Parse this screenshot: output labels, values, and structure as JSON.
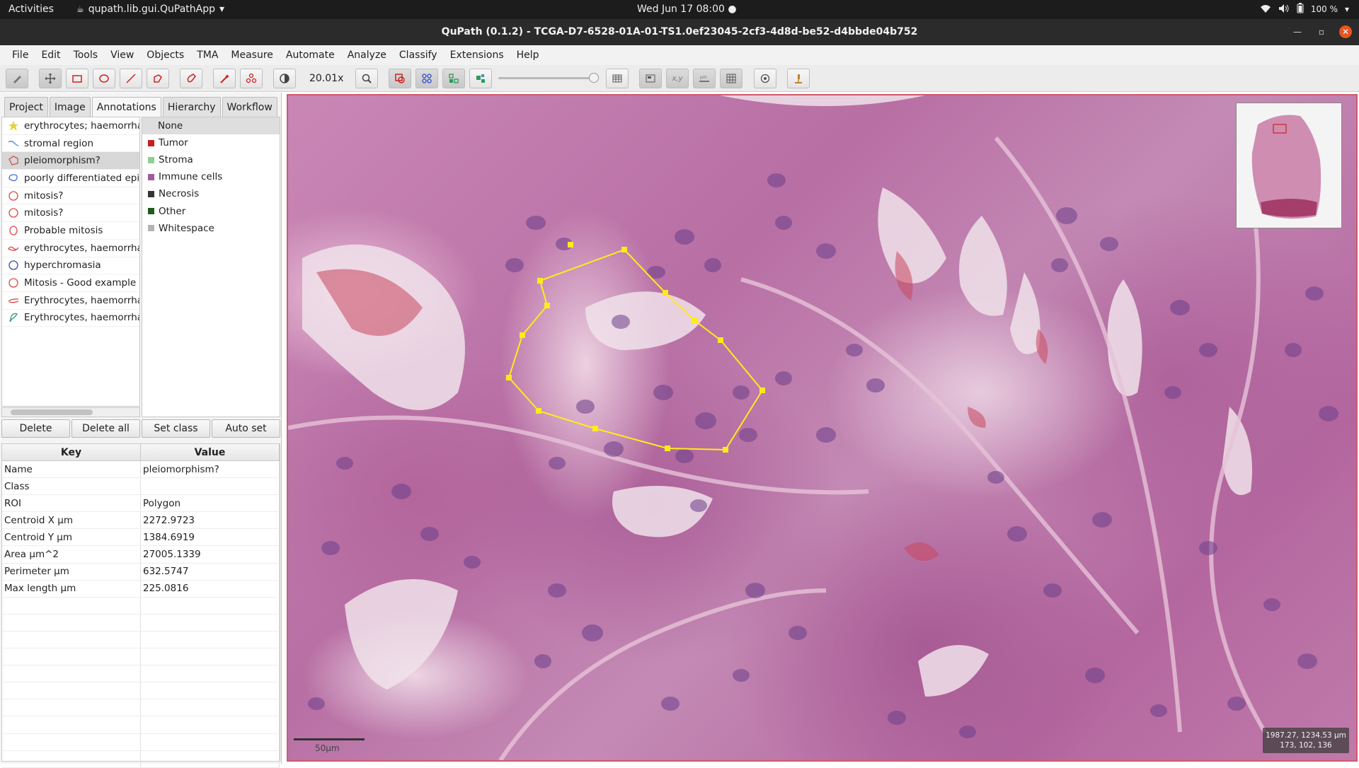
{
  "system": {
    "activities": "Activities",
    "app_menu": "qupath.lib.gui.QuPathApp",
    "clock": "Wed Jun 17  08:00",
    "battery": "100 %"
  },
  "window": {
    "title": "QuPath (0.1.2) - TCGA-D7-6528-01A-01-TS1.0ef23045-2cf3-4d8d-be52-d4bbde04b752"
  },
  "menu": [
    "File",
    "Edit",
    "Tools",
    "View",
    "Objects",
    "TMA",
    "Measure",
    "Automate",
    "Analyze",
    "Classify",
    "Extensions",
    "Help"
  ],
  "toolbar": {
    "zoom": "20.01x"
  },
  "tabs": [
    "Project",
    "Image",
    "Annotations",
    "Hierarchy",
    "Workflow"
  ],
  "selected_tab": "Annotations",
  "annotations": [
    {
      "label": "erythrocytes; haemorrhag",
      "icon": "star-icon",
      "color": "#e8d23a"
    },
    {
      "label": "stromal region",
      "icon": "polyline-icon",
      "color": "#6a8fd8"
    },
    {
      "label": "pleiomorphism?",
      "icon": "polygon-icon",
      "color": "#d84a4a"
    },
    {
      "label": "poorly differentiated epith",
      "icon": "polygon-icon",
      "color": "#4a6ad8"
    },
    {
      "label": "mitosis?",
      "icon": "ellipse-icon",
      "color": "#d84a4a"
    },
    {
      "label": "mitosis?",
      "icon": "ellipse-icon",
      "color": "#d84a4a"
    },
    {
      "label": "Probable mitosis",
      "icon": "ellipse-icon",
      "color": "#d84a4a"
    },
    {
      "label": "erythrocytes, haemorrhag",
      "icon": "polygon-icon",
      "color": "#d84a4a"
    },
    {
      "label": "hyperchromasia",
      "icon": "ellipse-icon",
      "color": "#3a4aa8"
    },
    {
      "label": "Mitosis - Good example",
      "icon": "ellipse-icon",
      "color": "#d84a4a"
    },
    {
      "label": "Erythrocytes, haemorrhag",
      "icon": "polyline-icon",
      "color": "#d84a4a"
    },
    {
      "label": "Erythrocytes, haemorrhag",
      "icon": "polygon-icon",
      "color": "#3a9a6a"
    }
  ],
  "selected_annotation": "pleiomorphism?",
  "classes": [
    {
      "label": "None",
      "color": ""
    },
    {
      "label": "Tumor",
      "color": "#c81e1e"
    },
    {
      "label": "Stroma",
      "color": "#8fcf8f"
    },
    {
      "label": "Immune cells",
      "color": "#a05aa0"
    },
    {
      "label": "Necrosis",
      "color": "#333333"
    },
    {
      "label": "Other",
      "color": "#1f5a1f"
    },
    {
      "label": "Whitespace",
      "color": "#b4b4b4"
    }
  ],
  "buttons": [
    "Delete",
    "Delete all",
    "Set class",
    "Auto set"
  ],
  "properties": {
    "headers": [
      "Key",
      "Value"
    ],
    "rows": [
      [
        "Name",
        "pleiomorphism?"
      ],
      [
        "Class",
        ""
      ],
      [
        "ROI",
        "Polygon"
      ],
      [
        "Centroid X µm",
        "2272.9723"
      ],
      [
        "Centroid Y µm",
        "1384.6919"
      ],
      [
        "Area µm^2",
        "27005.1339"
      ],
      [
        "Perimeter µm",
        "632.5747"
      ],
      [
        "Max length µm",
        "225.0816"
      ]
    ]
  },
  "viewer": {
    "coords_line1": "1987.27, 1234.53 µm",
    "coords_line2": "173, 102, 136",
    "scale_label": "50µm",
    "annotation_color": "#ffeb1a"
  }
}
